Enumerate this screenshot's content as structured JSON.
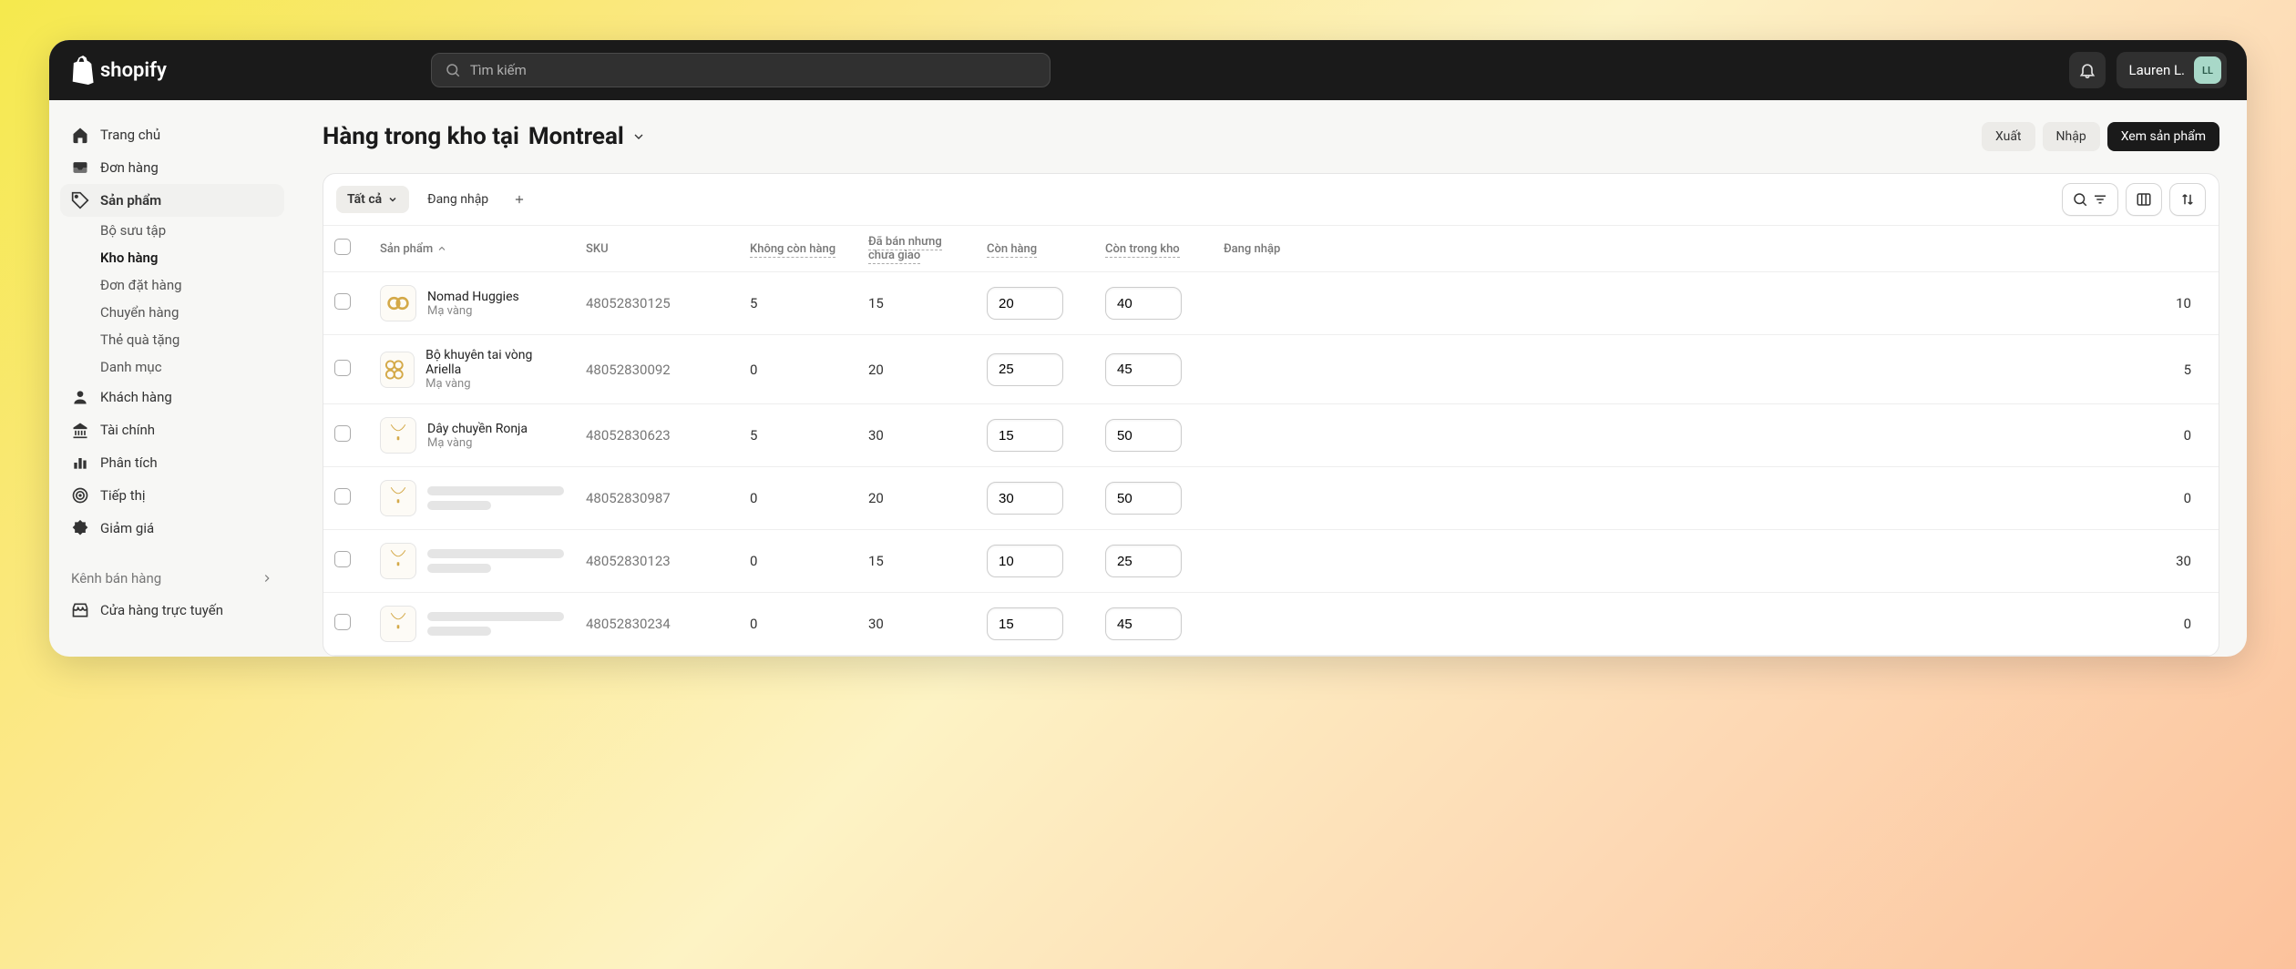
{
  "topbar": {
    "brand": "shopify",
    "search_placeholder": "Tìm kiếm",
    "user_name": "Lauren L.",
    "user_initials": "LL"
  },
  "nav": {
    "home": "Trang chủ",
    "orders": "Đơn hàng",
    "products": "Sản phẩm",
    "sub": {
      "collections": "Bộ sưu tập",
      "inventory": "Kho hàng",
      "purchase_orders": "Đơn đặt hàng",
      "transfers": "Chuyển hàng",
      "gift_cards": "Thẻ quà tặng",
      "catalogs": "Danh mục"
    },
    "customers": "Khách hàng",
    "finance": "Tài chính",
    "analytics": "Phân tích",
    "marketing": "Tiếp thị",
    "discounts": "Giảm giá",
    "channels_label": "Kênh bán hàng",
    "online_store": "Cửa hàng trực tuyến"
  },
  "page": {
    "title_prefix": "Hàng trong kho tại",
    "location": "Montreal",
    "actions": {
      "export": "Xuất",
      "import": "Nhập",
      "view_products": "Xem sản phẩm"
    }
  },
  "tabs": {
    "all": "Tất cả",
    "logging_in": "Đang nhập"
  },
  "columns": {
    "product": "Sản phẩm",
    "sku": "SKU",
    "unavailable": "Không còn hàng",
    "committed": "Đã bán nhưng chưa giao",
    "available": "Còn hàng",
    "on_hand": "Còn trong kho",
    "incoming": "Đang nhập"
  },
  "rows": [
    {
      "name": "Nomad Huggies",
      "variant": "Mạ vàng",
      "sku": "48052830125",
      "unavailable": "5",
      "committed": "15",
      "available": "20",
      "on_hand": "40",
      "incoming": "10",
      "skeleton": false,
      "icon": "hoops"
    },
    {
      "name": "Bộ khuyên tai vòng Ariella",
      "variant": "Mạ vàng",
      "sku": "48052830092",
      "unavailable": "0",
      "committed": "20",
      "available": "25",
      "on_hand": "45",
      "incoming": "5",
      "skeleton": false,
      "icon": "hoops3"
    },
    {
      "name": "Dây chuyền Ronja",
      "variant": "Mạ vàng",
      "sku": "48052830623",
      "unavailable": "5",
      "committed": "30",
      "available": "15",
      "on_hand": "50",
      "incoming": "0",
      "skeleton": false,
      "icon": "necklace"
    },
    {
      "name": "",
      "variant": "",
      "sku": "48052830987",
      "unavailable": "0",
      "committed": "20",
      "available": "30",
      "on_hand": "50",
      "incoming": "0",
      "skeleton": true,
      "icon": "necklace"
    },
    {
      "name": "",
      "variant": "",
      "sku": "48052830123",
      "unavailable": "0",
      "committed": "15",
      "available": "10",
      "on_hand": "25",
      "incoming": "30",
      "skeleton": true,
      "icon": "necklace"
    },
    {
      "name": "",
      "variant": "",
      "sku": "48052830234",
      "unavailable": "0",
      "committed": "30",
      "available": "15",
      "on_hand": "45",
      "incoming": "0",
      "skeleton": true,
      "icon": "necklace"
    }
  ]
}
